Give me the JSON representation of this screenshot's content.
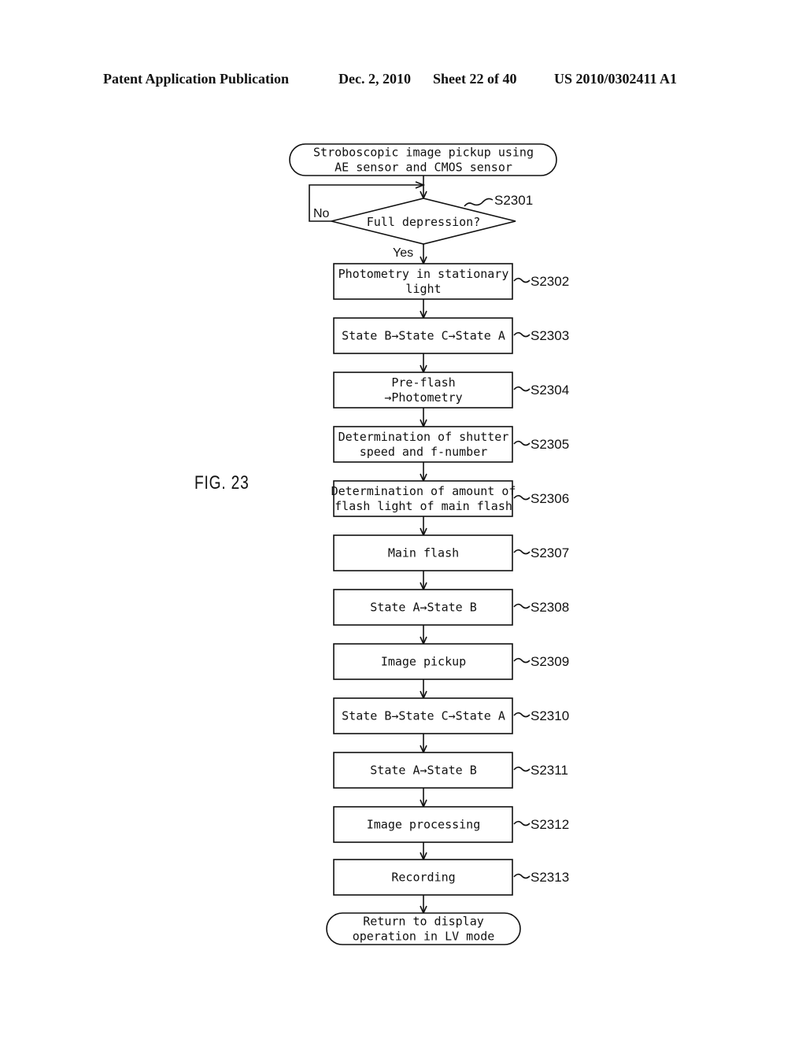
{
  "header": {
    "publication": "Patent Application Publication",
    "date": "Dec. 2, 2010",
    "sheet": "Sheet 22 of 40",
    "number": "US 2010/0302411 A1"
  },
  "figure_label": "FIG. 23",
  "flowchart": {
    "start": {
      "lines": [
        "Stroboscopic image pickup using",
        "AE sensor and CMOS sensor"
      ]
    },
    "decision": {
      "id": "S2301",
      "text": "Full depression?",
      "yes_label": "Yes",
      "no_label": "No"
    },
    "steps": [
      {
        "id": "S2302",
        "lines": [
          "Photometry in stationary",
          "light"
        ]
      },
      {
        "id": "S2303",
        "lines": [
          "State B→State C→State A"
        ]
      },
      {
        "id": "S2304",
        "lines": [
          "Pre-flash",
          "→Photometry"
        ]
      },
      {
        "id": "S2305",
        "lines": [
          "Determination of shutter",
          "speed and f-number"
        ]
      },
      {
        "id": "S2306",
        "lines": [
          "Determination of amount of",
          "flash light of main flash"
        ]
      },
      {
        "id": "S2307",
        "lines": [
          "Main flash"
        ]
      },
      {
        "id": "S2308",
        "lines": [
          "State A→State B"
        ]
      },
      {
        "id": "S2309",
        "lines": [
          "Image pickup"
        ]
      },
      {
        "id": "S2310",
        "lines": [
          "State B→State C→State A"
        ]
      },
      {
        "id": "S2311",
        "lines": [
          "State A→State B"
        ]
      },
      {
        "id": "S2312",
        "lines": [
          "Image processing"
        ]
      },
      {
        "id": "S2313",
        "lines": [
          "Recording"
        ]
      }
    ],
    "end": {
      "lines": [
        "Return to display",
        "operation in LV mode"
      ]
    }
  }
}
